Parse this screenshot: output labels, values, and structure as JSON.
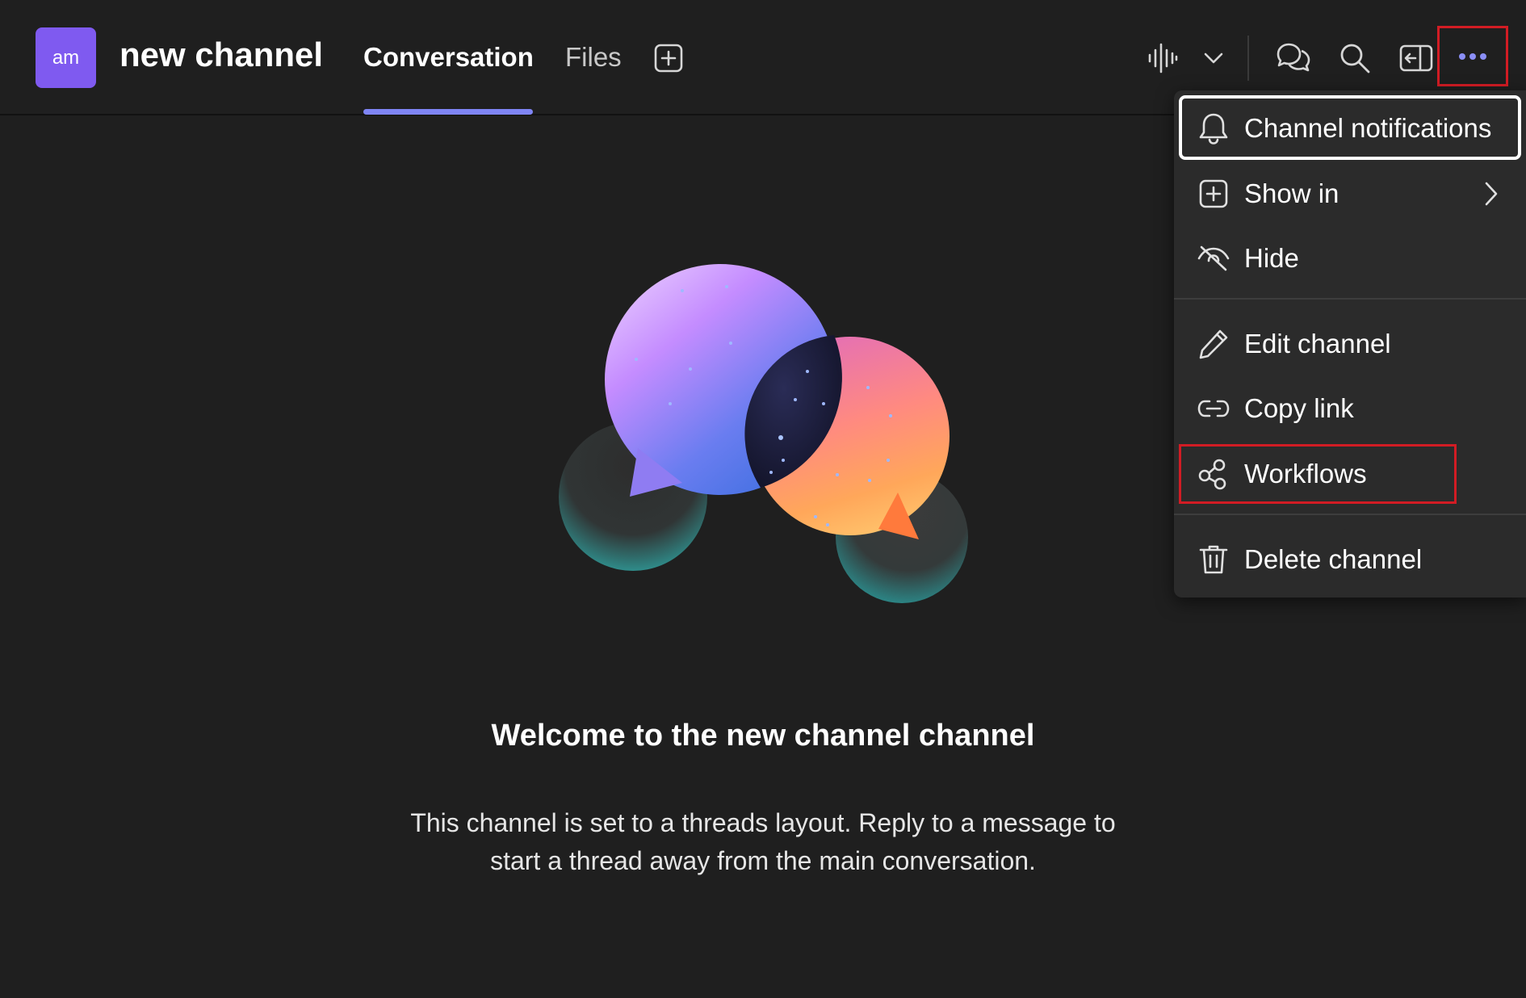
{
  "header": {
    "avatar_initials": "am",
    "channel_name": "new channel",
    "tabs": [
      {
        "label": "Conversation",
        "active": true
      },
      {
        "label": "Files",
        "active": false
      }
    ],
    "icons": [
      "add-tab-icon",
      "audio-waveform-icon",
      "chevron-down-icon",
      "chat-bubbles-icon",
      "search-icon",
      "pop-out-icon",
      "more-options-icon"
    ]
  },
  "menu": {
    "items": [
      {
        "label": "Channel notifications",
        "icon": "bell-icon"
      },
      {
        "label": "Show in",
        "icon": "add-square-icon",
        "submenu": true
      },
      {
        "label": "Hide",
        "icon": "eye-off-icon"
      },
      {
        "label": "Edit channel",
        "icon": "pencil-icon"
      },
      {
        "label": "Copy link",
        "icon": "link-icon"
      },
      {
        "label": "Workflows",
        "icon": "workflows-icon"
      },
      {
        "label": "Delete channel",
        "icon": "trash-icon"
      }
    ]
  },
  "main": {
    "welcome_title": "Welcome to the new channel channel",
    "welcome_line1": "This channel is set to a threads layout. Reply to a message to",
    "welcome_line2": "start a thread away from the main conversation."
  },
  "colors": {
    "background": "#1f1f1f",
    "accent": "#7f85f5",
    "avatar": "#7f5af0",
    "menu_bg": "#2b2b2b",
    "highlight": "#d21c24"
  }
}
